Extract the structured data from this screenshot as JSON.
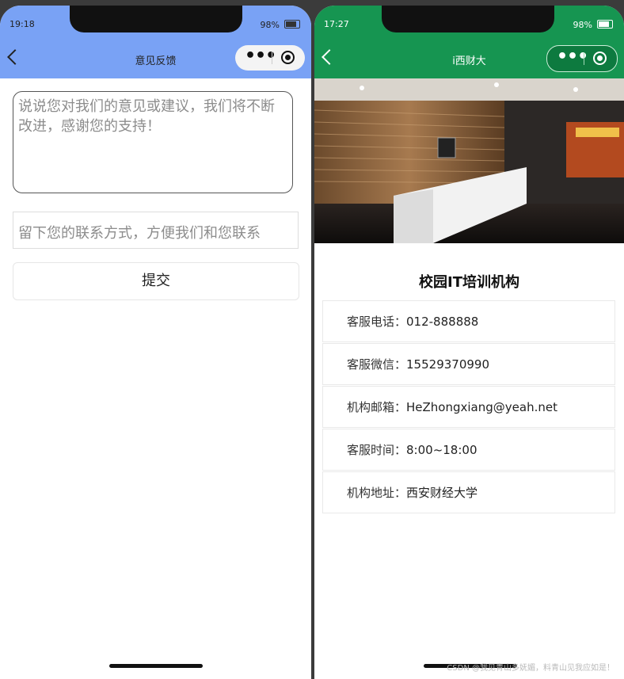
{
  "left_phone": {
    "status": {
      "time": "19:18",
      "battery": "98%"
    },
    "navbar": {
      "title": "意见反馈"
    },
    "feedback_placeholder": "说说您对我们的意见或建议，我们将不断改进，感谢您的支持！",
    "contact_placeholder": "留下您的联系方式，方便我们和您联系",
    "submit_label": "提交",
    "accent": "#79a2f5"
  },
  "right_phone": {
    "status": {
      "time": "17:27",
      "battery": "98%"
    },
    "navbar": {
      "title": "i西财大"
    },
    "org_title": "校园IT培训机构",
    "info": [
      {
        "label": "客服电话：",
        "value": "012-888888"
      },
      {
        "label": "客服微信：",
        "value": "15529370990"
      },
      {
        "label": "机构邮箱：",
        "value": "HeZhongxiang@yeah.net"
      },
      {
        "label": "客服时间：",
        "value": "8:00~18:00"
      },
      {
        "label": "机构地址：",
        "value": "西安财经大学"
      }
    ],
    "accent": "#169551"
  },
  "watermark": "CSDN @我见青山多妩媚，料青山见我应如是！"
}
